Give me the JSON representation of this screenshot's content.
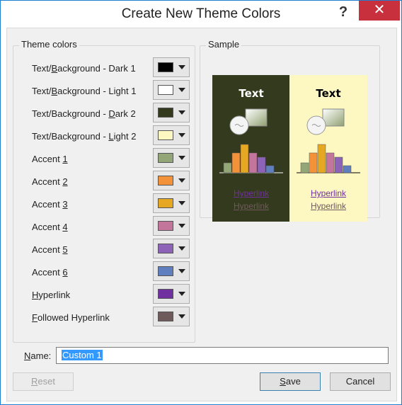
{
  "window": {
    "title": "Create New Theme Colors",
    "help_glyph": "?",
    "close_glyph": "✕"
  },
  "theme_colors": {
    "legend": "Theme colors",
    "rows": [
      {
        "pre": "Text/",
        "key": "B",
        "post": "ackground - Dark 1",
        "color": "#000000",
        "name": "text-background-dark-1"
      },
      {
        "pre": "Text/",
        "key": "B",
        "post": "ackground - Light 1",
        "color": "#ffffff",
        "name": "text-background-light-1"
      },
      {
        "pre": "Text/Background - ",
        "key": "D",
        "post": "ark 2",
        "color": "#343a1e",
        "name": "text-background-dark-2"
      },
      {
        "pre": "Text/Background - ",
        "key": "L",
        "post": "ight 2",
        "color": "#fdf8c2",
        "name": "text-background-light-2"
      },
      {
        "pre": "Accent ",
        "key": "1",
        "post": "",
        "color": "#93a677",
        "name": "accent-1"
      },
      {
        "pre": "Accent ",
        "key": "2",
        "post": "",
        "color": "#f4923a",
        "name": "accent-2"
      },
      {
        "pre": "Accent ",
        "key": "3",
        "post": "",
        "color": "#e6a822",
        "name": "accent-3"
      },
      {
        "pre": "Accent ",
        "key": "4",
        "post": "",
        "color": "#c4759c",
        "name": "accent-4"
      },
      {
        "pre": "Accent ",
        "key": "5",
        "post": "",
        "color": "#8c63b6",
        "name": "accent-5"
      },
      {
        "pre": "Accent ",
        "key": "6",
        "post": "",
        "color": "#5f7fbf",
        "name": "accent-6"
      },
      {
        "pre": "",
        "key": "H",
        "post": "yperlink",
        "color": "#7030a0",
        "name": "hyperlink"
      },
      {
        "pre": "",
        "key": "F",
        "post": "ollowed Hyperlink",
        "color": "#6e5a5a",
        "name": "followed-hyperlink"
      }
    ]
  },
  "sample": {
    "legend": "Sample",
    "text_label": "Text",
    "hyperlink_label": "Hyperlink",
    "followed_label": "Hyperlink",
    "dark_bg": "#343a1e",
    "light_bg": "#fdf8c2",
    "dark_text_color": "#ffffff",
    "light_text_color": "#000000",
    "hyperlink_color": "#7030a0",
    "followed_color": "#6e5a5a"
  },
  "name_field": {
    "pre": "",
    "key": "N",
    "post": "ame:",
    "value": "Custom 1"
  },
  "buttons": {
    "reset": {
      "pre": "",
      "key": "R",
      "post": "eset"
    },
    "save": {
      "pre": "",
      "key": "S",
      "post": "ave"
    },
    "cancel": "Cancel"
  }
}
